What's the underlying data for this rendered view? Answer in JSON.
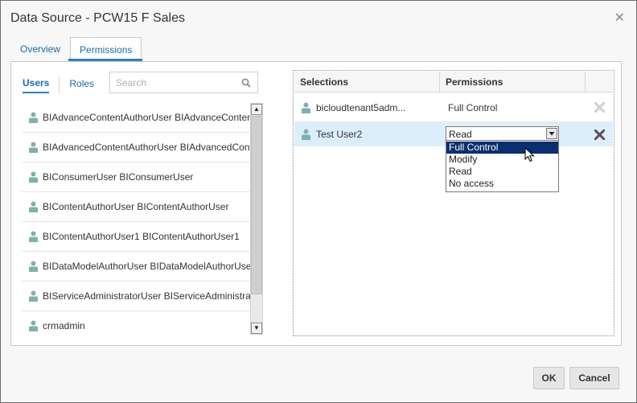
{
  "dialog": {
    "title": "Data Source - PCW15 F Sales",
    "close_glyph": "✕"
  },
  "tabs": [
    {
      "label": "Overview"
    },
    {
      "label": "Permissions",
      "active": true
    }
  ],
  "left_panel": {
    "tabs": [
      {
        "label": "Users",
        "active": true
      },
      {
        "label": "Roles"
      }
    ],
    "search": {
      "placeholder": "Search",
      "value": ""
    },
    "users": [
      {
        "label": "BIAdvanceContentAuthorUser BIAdvanceContentAuthorUser"
      },
      {
        "label": "BIAdvancedContentAuthorUser BIAdvancedContentAuthorUser"
      },
      {
        "label": "BIConsumerUser BIConsumerUser"
      },
      {
        "label": "BIContentAuthorUser BIContentAuthorUser"
      },
      {
        "label": "BIContentAuthorUser1 BIContentAuthorUser1"
      },
      {
        "label": "BIDataModelAuthorUser BIDataModelAuthorUser"
      },
      {
        "label": "BIServiceAdministratorUser BIServiceAdministratorUser"
      },
      {
        "label": "crmadmin"
      }
    ]
  },
  "selections": {
    "headers": {
      "selections": "Selections",
      "permissions": "Permissions"
    },
    "rows": [
      {
        "name": "bicloudtenant5adm...",
        "permission": "Full Control",
        "delete_enabled": false
      },
      {
        "name": "Test User2",
        "permission": "Read",
        "delete_enabled": true,
        "selected": true
      }
    ],
    "dropdown_options": [
      "Full Control",
      "Modify",
      "Read",
      "No access"
    ],
    "dropdown_highlighted": "Full Control"
  },
  "buttons": {
    "ok": "OK",
    "cancel": "Cancel"
  },
  "colors": {
    "accent": "#2f7fc1",
    "link": "#1f6aa5",
    "user_icon": "#7fb0ad",
    "selected_row": "#ddeefb",
    "highlight": "#0b2f6e"
  }
}
